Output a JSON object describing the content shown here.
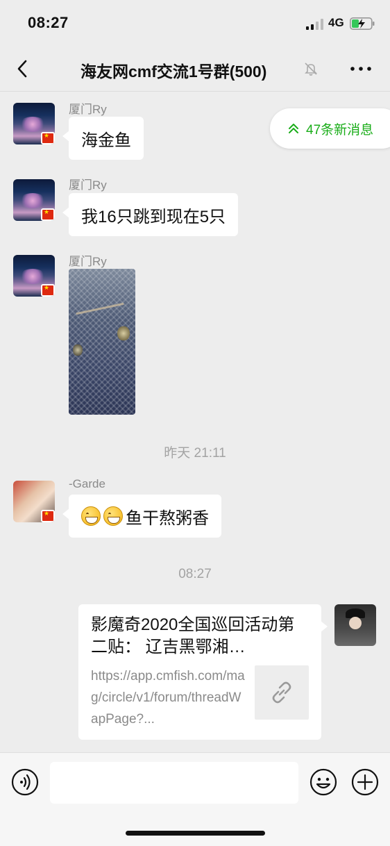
{
  "status_bar": {
    "time": "08:27",
    "network": "4G"
  },
  "header": {
    "title": "海友网cmf交流1号群(500)"
  },
  "new_messages": {
    "label": "47条新消息"
  },
  "messages": [
    {
      "sender": "厦门Ry",
      "text": "海金鱼"
    },
    {
      "sender": "厦门Ry",
      "text": "我16只跳到现在5只"
    },
    {
      "sender": "厦门Ry",
      "type": "image"
    },
    {
      "sender": "-Garde",
      "text": "鱼干熬粥香",
      "emoji": [
        "grin",
        "grin"
      ]
    }
  ],
  "timestamps": [
    "昨天 21:11",
    "08:27"
  ],
  "link_card": {
    "title": "影魔奇2020全国巡回活动第二贴： 辽吉黑鄂湘…",
    "url": "https://app.cmfish.com/mag/circle/v1/forum/threadWapPage?..."
  },
  "icons": {
    "back": "back-chevron-icon",
    "mute": "bell-off-icon",
    "more": "ellipsis-icon",
    "new_messages": "double-chevron-up-icon",
    "link": "link-icon",
    "voice": "voice-icon",
    "emoji": "smiley-icon",
    "plus": "plus-icon"
  },
  "colors": {
    "accent": "#1aad19",
    "background": "#ededed",
    "flag": "#de2910"
  }
}
